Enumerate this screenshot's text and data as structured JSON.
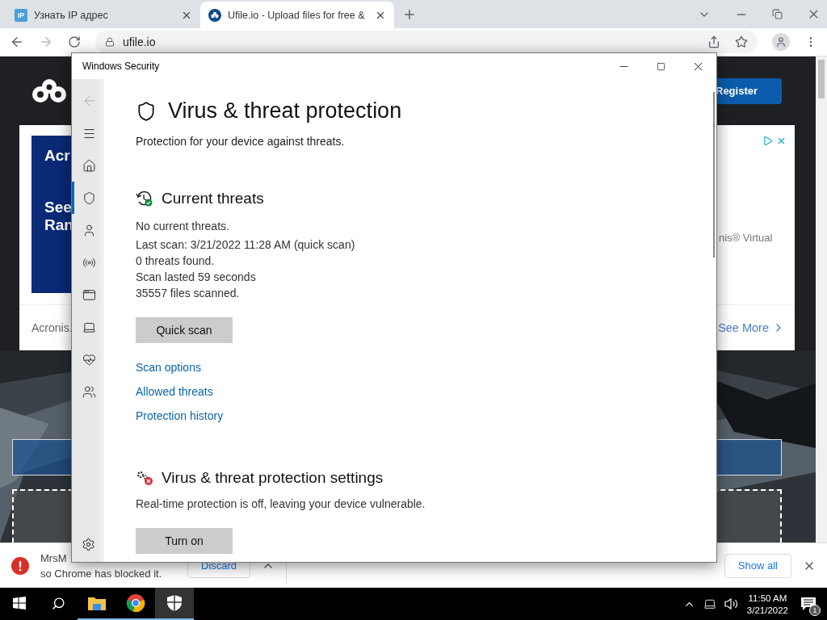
{
  "browser": {
    "tabs": [
      {
        "favicon": "IP",
        "title": "Узнать IP адрес",
        "selected": false
      },
      {
        "title": "Ufile.io - Upload files for free &",
        "selected": true
      }
    ],
    "address": "ufile.io"
  },
  "site": {
    "register": "Register",
    "ad": {
      "image_lines": [
        "Acr",
        "See",
        "Ran"
      ],
      "side_text": "nis® Virtual",
      "brand": "Acronis.",
      "cta": "See More"
    }
  },
  "dialog": {
    "title": "Windows Security",
    "nav": [
      {
        "kind": "back",
        "disabled": true,
        "selected": false
      },
      {
        "kind": "menu",
        "selected": false
      },
      {
        "kind": "home",
        "selected": false
      },
      {
        "kind": "shield",
        "selected": true
      },
      {
        "kind": "account",
        "selected": false
      },
      {
        "kind": "network",
        "selected": false
      },
      {
        "kind": "app",
        "selected": false
      },
      {
        "kind": "device",
        "selected": false
      },
      {
        "kind": "health",
        "selected": false
      },
      {
        "kind": "family",
        "selected": false
      }
    ],
    "heading": "Virus & threat protection",
    "subtitle": "Protection for your device against threats.",
    "current": {
      "title": "Current threats",
      "lines": [
        "No current threats.",
        "Last scan: 3/21/2022 11:28 AM (quick scan)",
        "0 threats found.",
        "Scan lasted 59 seconds",
        "35557 files scanned."
      ],
      "button": "Quick scan",
      "links": [
        "Scan options",
        "Allowed threats",
        "Protection history"
      ]
    },
    "settings": {
      "title": "Virus & threat protection settings",
      "text": "Real-time protection is off, leaving your device vulnerable.",
      "button": "Turn on"
    }
  },
  "download": {
    "name": "MrsM",
    "message": "so Chrome has blocked it.",
    "discard": "Discard",
    "show_all": "Show all"
  },
  "taskbar": {
    "apps": [
      {
        "kind": "explorer",
        "active": false
      },
      {
        "kind": "chrome",
        "active": false
      },
      {
        "kind": "security",
        "active": true
      }
    ],
    "time": "11:50 AM",
    "date": "3/21/2022",
    "notifications": "1"
  }
}
